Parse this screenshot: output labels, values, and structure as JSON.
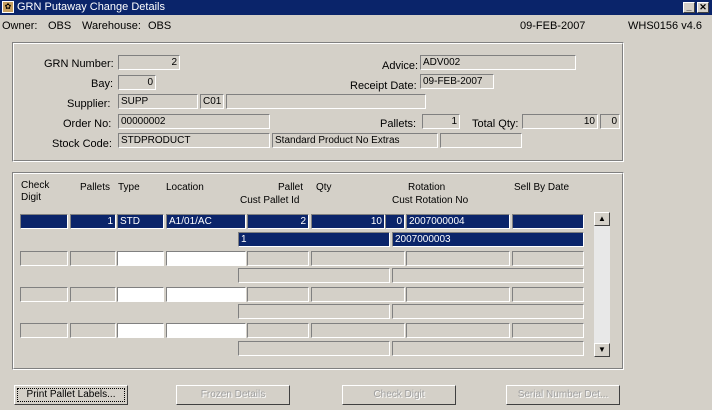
{
  "window": {
    "title": "GRN Putaway Change Details",
    "minimize_label": "_",
    "close_label": "✕"
  },
  "info": {
    "owner_label": "Owner:",
    "owner_value": "OBS",
    "warehouse_label": "Warehouse:",
    "warehouse_value": "OBS",
    "date": "09-FEB-2007",
    "form_id": "WHS0156 v4.6"
  },
  "header": {
    "grn_label": "GRN Number:",
    "grn_value": "2",
    "bay_label": "Bay:",
    "bay_value": "0",
    "supplier_label": "Supplier:",
    "supplier_code": "SUPP",
    "supplier_sub": "C01",
    "supplier_name": "",
    "order_label": "Order No:",
    "order_value": "00000002",
    "stock_label": "Stock Code:",
    "stock_code": "STDPRODUCT",
    "stock_desc": "Standard Product No Extras",
    "stock_extra": "",
    "advice_label": "Advice:",
    "advice_value": "ADV002",
    "receipt_label": "Receipt Date:",
    "receipt_value": "09-FEB-2007",
    "pallets_label": "Pallets:",
    "pallets_value": "1",
    "total_label": "Total Qty:",
    "total_value": "10",
    "total_extra": "0"
  },
  "grid": {
    "headers": {
      "check_digit": "Check\nDigit",
      "pallets": "Pallets",
      "type": "Type",
      "location": "Location",
      "pallet": "Pallet",
      "cust_pallet": "Cust Pallet Id",
      "qty": "Qty",
      "rotation": "Rotation",
      "cust_rotation": "Cust Rotation No",
      "sell_by": "Sell By Date"
    },
    "rows": [
      {
        "check": "",
        "pallets": "1",
        "type": "STD",
        "location": "A1/01/AC",
        "pallet": "2",
        "qty": "10",
        "qty_extra": "0",
        "rotation": "2007000004",
        "sell_by": "",
        "cust_pallet": "1",
        "cust_rotation": "2007000003"
      },
      {
        "check": "",
        "pallets": "",
        "type": "",
        "location": "",
        "pallet": "",
        "qty": "",
        "qty_extra": "",
        "rotation": "",
        "sell_by": "",
        "cust_pallet": "",
        "cust_rotation": ""
      },
      {
        "check": "",
        "pallets": "",
        "type": "",
        "location": "",
        "pallet": "",
        "qty": "",
        "qty_extra": "",
        "rotation": "",
        "sell_by": "",
        "cust_pallet": "",
        "cust_rotation": ""
      },
      {
        "check": "",
        "pallets": "",
        "type": "",
        "location": "",
        "pallet": "",
        "qty": "",
        "qty_extra": "",
        "rotation": "",
        "sell_by": "",
        "cust_pallet": "",
        "cust_rotation": ""
      }
    ],
    "scroll_up": "▲",
    "scroll_down": "▼"
  },
  "buttons": {
    "print": "Print Pallet Labels...",
    "frozen": "Frozen Details",
    "check": "Check Digit",
    "serial": "Serial Number Det..."
  }
}
